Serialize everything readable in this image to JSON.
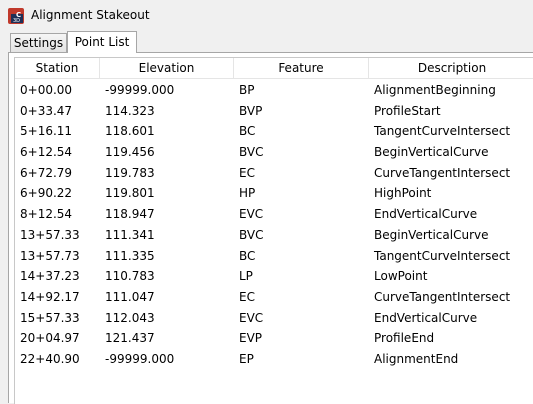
{
  "window": {
    "title": "Alignment Stakeout",
    "app_icon": "c3d-app-icon"
  },
  "tabs": [
    {
      "label": "Settings",
      "active": false
    },
    {
      "label": "Point List",
      "active": true
    }
  ],
  "table": {
    "columns": [
      "Station",
      "Elevation",
      "Feature",
      "Description"
    ],
    "rows": [
      [
        "0+00.00",
        "-99999.000",
        "BP",
        "AlignmentBeginning"
      ],
      [
        "0+33.47",
        "114.323",
        "BVP",
        "ProfileStart"
      ],
      [
        "5+16.11",
        "118.601",
        "BC",
        "TangentCurveIntersect"
      ],
      [
        "6+12.54",
        "119.456",
        "BVC",
        "BeginVerticalCurve"
      ],
      [
        "6+72.79",
        "119.783",
        "EC",
        "CurveTangentIntersect"
      ],
      [
        "6+90.22",
        "119.801",
        "HP",
        "HighPoint"
      ],
      [
        "8+12.54",
        "118.947",
        "EVC",
        "EndVerticalCurve"
      ],
      [
        "13+57.33",
        "111.341",
        "BVC",
        "BeginVerticalCurve"
      ],
      [
        "13+57.73",
        "111.335",
        "BC",
        "TangentCurveIntersect"
      ],
      [
        "14+37.23",
        "110.783",
        "LP",
        "LowPoint"
      ],
      [
        "14+92.17",
        "111.047",
        "EC",
        "CurveTangentIntersect"
      ],
      [
        "15+57.33",
        "112.043",
        "EVC",
        "EndVerticalCurve"
      ],
      [
        "20+04.97",
        "121.437",
        "EVP",
        "ProfileEnd"
      ],
      [
        "22+40.90",
        "-99999.000",
        "EP",
        "AlignmentEnd"
      ]
    ]
  }
}
